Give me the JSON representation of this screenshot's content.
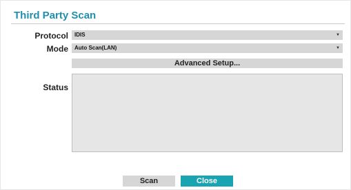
{
  "dialog": {
    "title": "Third Party Scan"
  },
  "protocol": {
    "label": "Protocol",
    "value": "IDIS"
  },
  "mode": {
    "label": "Mode",
    "value": "Auto Scan(LAN)"
  },
  "advanced": {
    "label": "Advanced Setup..."
  },
  "status": {
    "label": "Status"
  },
  "buttons": {
    "scan": "Scan",
    "close": "Close"
  },
  "icons": {
    "dropdown": "chevron-down-icon"
  },
  "colors": {
    "accent": "#1aa3b0",
    "title": "#1f8fb0",
    "field_bg": "#d6d6d6",
    "status_bg": "#e6e6e6"
  }
}
